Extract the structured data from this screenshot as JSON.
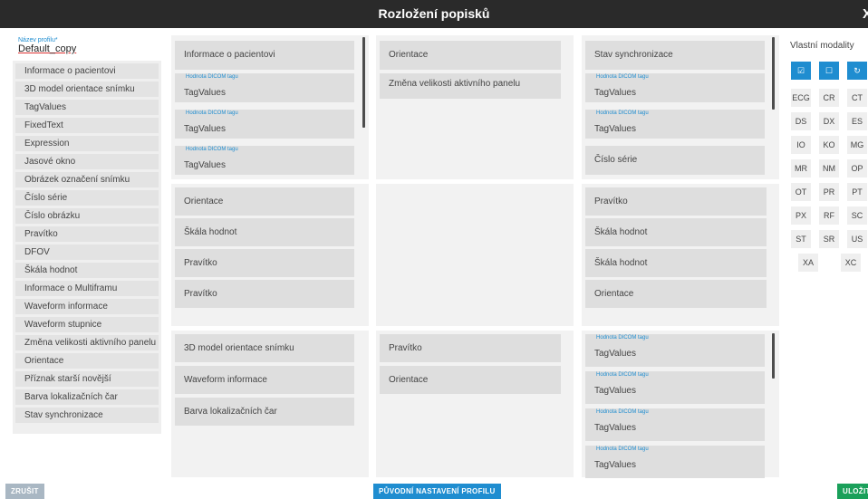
{
  "window": {
    "title": "Rozložení popisků",
    "close_label": "X"
  },
  "profile": {
    "label": "Název profilu*",
    "value": "Default_copy"
  },
  "left_items": [
    "Informace o pacientovi",
    "3D model orientace snímku",
    "TagValues",
    "FixedText",
    "Expression",
    "Jasové okno",
    "Obrázek označení snímku",
    "Číslo série",
    "Číslo obrázku",
    "Pravítko",
    "DFOV",
    "Škála hodnot",
    "Informace o Multiframu",
    "Waveform informace",
    "Waveform stupnice",
    "Změna velikosti aktivního panelu",
    "Orientace",
    "Příznak starší novější",
    "Barva lokalizačních čar",
    "Stav synchronizace"
  ],
  "grid": {
    "tag_label": "Hodnota DICOM tagu",
    "top_left": [
      "Informace o pacientovi",
      "TagValues",
      "TagValues",
      "TagValues"
    ],
    "top_center": [
      "Orientace",
      "Změna velikosti aktivního panelu"
    ],
    "top_right": [
      "Stav synchronizace",
      "TagValues",
      "TagValues",
      "Číslo série"
    ],
    "mid_left": [
      "Orientace",
      "Škála hodnot",
      "Pravítko",
      "Pravítko"
    ],
    "mid_right": [
      "Pravítko",
      "Škála hodnot",
      "Škála hodnot",
      "Orientace"
    ],
    "bot_left": [
      "3D model orientace snímku",
      "Waveform informace",
      "Barva lokalizačních čar"
    ],
    "bot_center": [
      "Pravítko",
      "Orientace"
    ],
    "bot_right": [
      "TagValues",
      "TagValues",
      "TagValues",
      "TagValues"
    ]
  },
  "modalities": {
    "title": "Vlastní modality",
    "actions": [
      "select-all-icon",
      "deselect-all-icon",
      "reset-icon"
    ],
    "items": [
      "ECG",
      "CR",
      "CT",
      "DS",
      "DX",
      "ES",
      "IO",
      "KO",
      "MG",
      "MR",
      "NM",
      "OP",
      "OT",
      "PR",
      "PT",
      "PX",
      "RF",
      "SC",
      "ST",
      "SR",
      "US",
      "XA",
      "XC"
    ]
  },
  "buttons": {
    "cancel": "ZRUŠIT",
    "reset": "PŮVODNÍ NASTAVENÍ PROFILU",
    "save": "ULOŽIT"
  },
  "colors": {
    "accent": "#1f8dd0",
    "save": "#1aa05a",
    "cancel": "#a9b7c3",
    "titlebar": "#2a2a2a"
  }
}
